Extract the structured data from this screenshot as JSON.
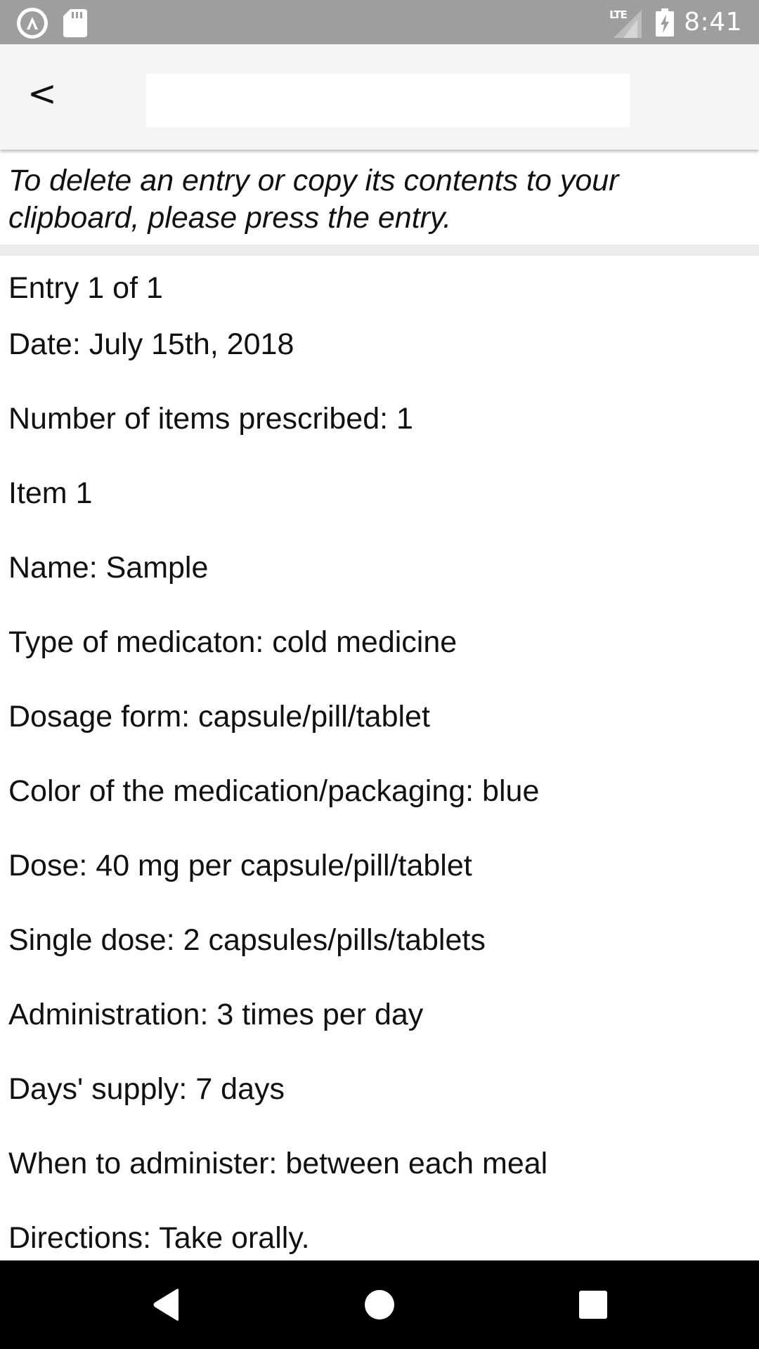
{
  "status_bar": {
    "network": "LTE",
    "time": "8:41"
  },
  "toolbar": {
    "back_label": "<",
    "title": ""
  },
  "instruction": "To delete an entry or copy its contents to your clipboard, please press the entry.",
  "entry": {
    "counter": "Entry 1 of 1",
    "lines": [
      "Date: July 15th, 2018",
      "Number of items prescribed: 1",
      "Item 1",
      "Name: Sample",
      "Type of medicaton: cold medicine",
      "Dosage form: capsule/pill/tablet",
      "Color of the medication/packaging: blue",
      "Dose: 40 mg per capsule/pill/tablet",
      "Single dose: 2 capsules/pills/tablets",
      "Administration: 3 times per day",
      "Days' supply: 7 days",
      "When to administer: between each meal",
      "Directions: Take orally."
    ]
  },
  "icons": {
    "status_left": [
      "app-notification-icon",
      "sd-card-icon"
    ],
    "status_right": [
      "lte-signal-icon",
      "battery-charging-icon"
    ],
    "nav": [
      "back-triangle-icon",
      "home-circle-icon",
      "recents-square-icon"
    ]
  },
  "colors": {
    "status_bar": "#9e9e9e",
    "toolbar": "#f5f5f5",
    "nav_bar": "#000000",
    "divider": "#ececec"
  }
}
